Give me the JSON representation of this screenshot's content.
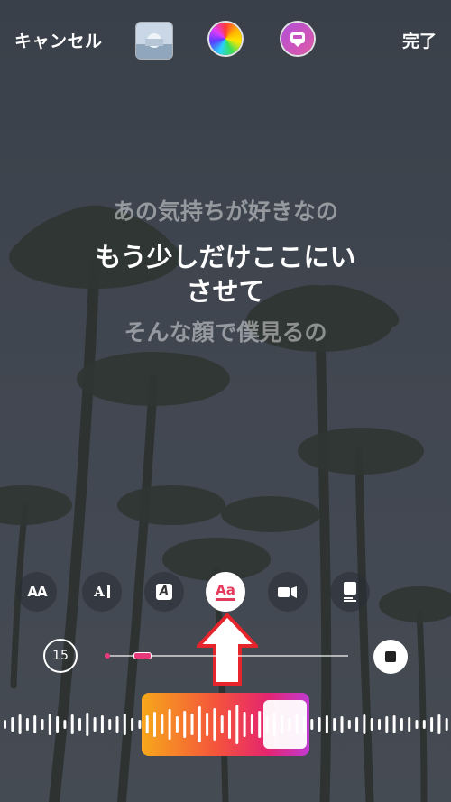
{
  "header": {
    "cancel_label": "キャンセル",
    "done_label": "完了",
    "thumbnail_icon": "album-thumbnail",
    "color_icon": "color-wheel-icon",
    "sticker_icon": "music-sticker-icon"
  },
  "lyrics": {
    "previous": "あの気持ちが好きなの",
    "current_line1": "もう少しだけここにい",
    "current_line2": "させて",
    "next": "そんな顔で僕見るの"
  },
  "styles": {
    "items": [
      {
        "name": "text-style-lyrics",
        "label": "AA",
        "selected": false
      },
      {
        "name": "text-style-typewriter",
        "label": "A",
        "selected": false
      },
      {
        "name": "text-style-box",
        "label": "A",
        "selected": false
      },
      {
        "name": "text-style-underline",
        "label": "Aa",
        "selected": true
      },
      {
        "name": "text-style-album-small",
        "label": "",
        "selected": false
      },
      {
        "name": "text-style-album-large",
        "label": "",
        "selected": false
      }
    ],
    "accent_color": "#e33a5b"
  },
  "player": {
    "duration": "15",
    "stop_icon": "stop-icon"
  },
  "colors": {
    "selection_gradient": [
      "#f7a81b",
      "#f4533c",
      "#e5256f",
      "#c13ad2"
    ]
  }
}
